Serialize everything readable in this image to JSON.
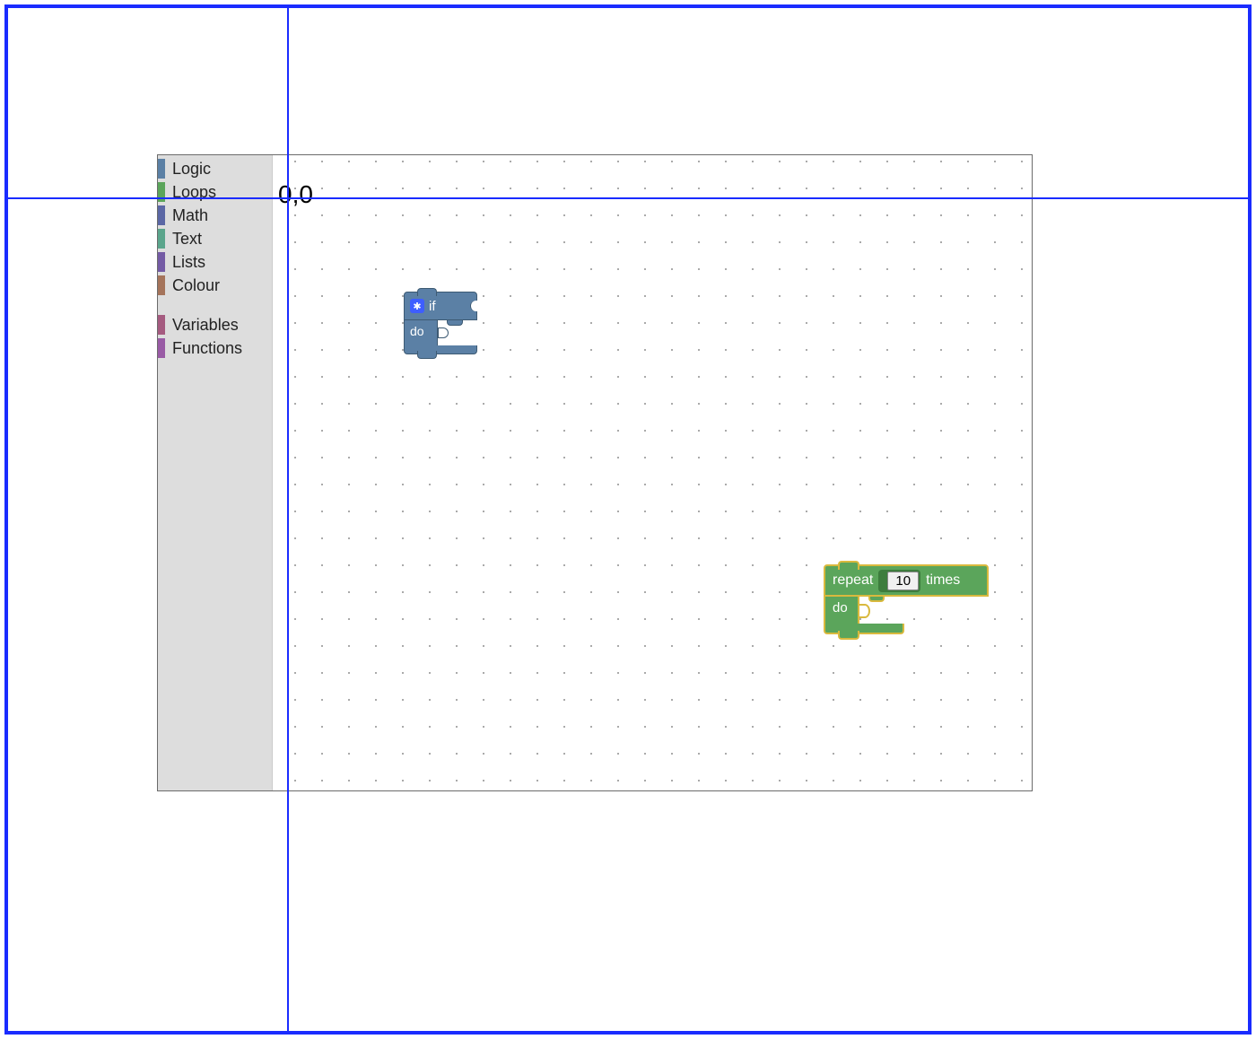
{
  "toolbox": {
    "categories": [
      {
        "label": "Logic",
        "color": "#5b80a5"
      },
      {
        "label": "Loops",
        "color": "#5ba55b"
      },
      {
        "label": "Math",
        "color": "#5b67a5"
      },
      {
        "label": "Text",
        "color": "#5ba58c"
      },
      {
        "label": "Lists",
        "color": "#745ba5"
      },
      {
        "label": "Colour",
        "color": "#a5745b"
      }
    ],
    "extra": [
      {
        "label": "Variables",
        "color": "#a55b80"
      },
      {
        "label": "Functions",
        "color": "#995ba5"
      }
    ]
  },
  "workspace": {
    "origin_label": "0,0",
    "blocks": {
      "if_block": {
        "if_label": "if",
        "do_label": "do",
        "gear_icon": "gear-icon"
      },
      "repeat_block": {
        "repeat_label": "repeat",
        "times_label": "times",
        "do_label": "do",
        "count_value": "10"
      }
    }
  },
  "colors": {
    "frame": "#1a2cff",
    "logic_block": "#5b80a5",
    "loop_block": "#5ba55b",
    "loop_selected_outline": "#d9b93e"
  }
}
